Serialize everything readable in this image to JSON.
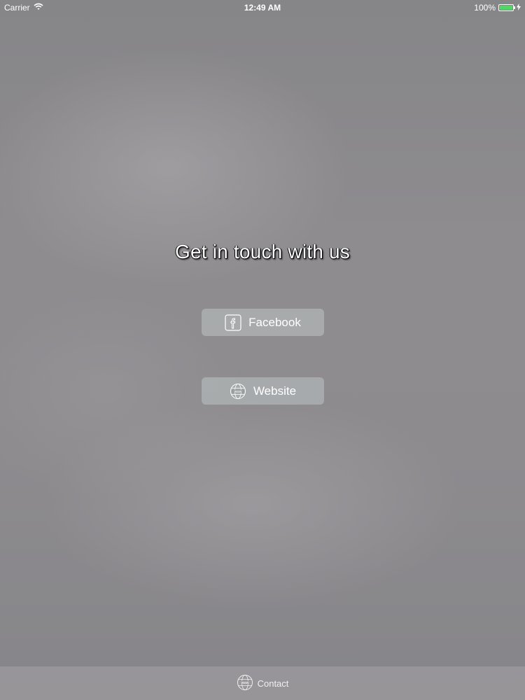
{
  "status_bar": {
    "carrier": "Carrier",
    "time": "12:49 AM",
    "battery_percent": "100%",
    "battery_level": 1.0,
    "battery_color": "#4cd964"
  },
  "main": {
    "heading": "Get in touch with us",
    "buttons": [
      {
        "label": "Facebook",
        "icon": "facebook-icon"
      },
      {
        "label": "Website",
        "icon": "globe-www-icon"
      }
    ]
  },
  "tab_bar": {
    "items": [
      {
        "label": "Contact",
        "icon": "globe-www-icon"
      }
    ]
  }
}
